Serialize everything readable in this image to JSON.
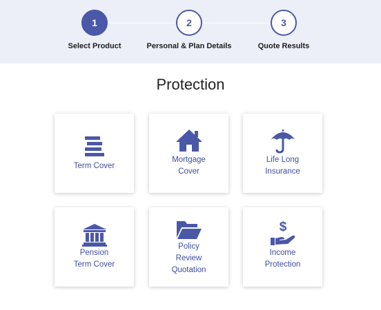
{
  "stepper": {
    "steps": [
      {
        "number": "1",
        "label": "Select Product",
        "active": true
      },
      {
        "number": "2",
        "label": "Personal & Plan Details",
        "active": false
      },
      {
        "number": "3",
        "label": "Quote Results",
        "active": false
      }
    ]
  },
  "page": {
    "title": "Protection"
  },
  "products": [
    {
      "icon": "stacked-bars-icon",
      "label_lines": [
        "Term Cover"
      ]
    },
    {
      "icon": "house-icon",
      "label_lines": [
        "Mortgage",
        "Cover"
      ]
    },
    {
      "icon": "umbrella-icon",
      "label_lines": [
        "Life Long",
        "Insurance"
      ]
    },
    {
      "icon": "bank-building-icon",
      "label_lines": [
        "Pension",
        "Term Cover"
      ]
    },
    {
      "icon": "folder-open-icon",
      "label_lines": [
        "Policy",
        "Review",
        "Quotation"
      ]
    },
    {
      "icon": "hand-dollar-icon",
      "label_lines": [
        "Income",
        "Protection"
      ]
    }
  ],
  "colors": {
    "accent": "#4a58a8",
    "stepper_background": "#eceff7",
    "card_text": "#3e4da0"
  }
}
